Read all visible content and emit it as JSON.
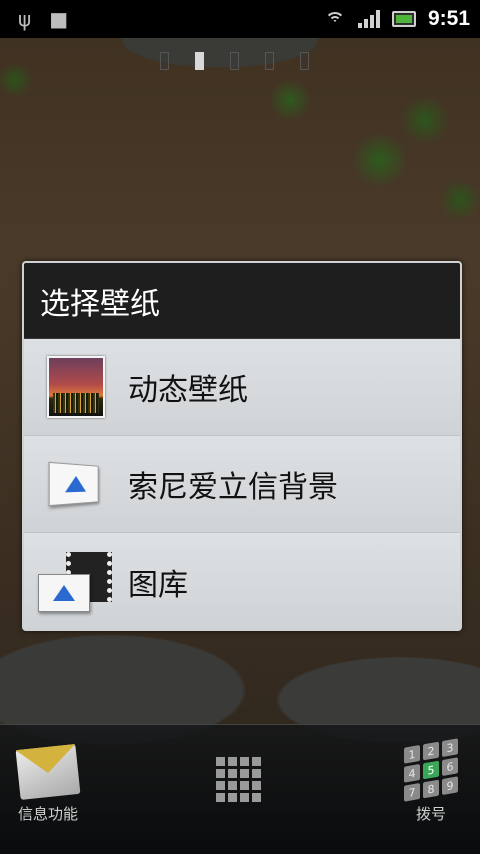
{
  "status_bar": {
    "time": "9:51",
    "left_icons": [
      "usb-icon",
      "android-debug-icon"
    ],
    "right_icons": [
      "wifi-icon",
      "signal-icon",
      "battery-charging-icon"
    ]
  },
  "home": {
    "page_count": 5,
    "active_page": 2
  },
  "dialog": {
    "title": "选择壁纸",
    "options": [
      {
        "label": "动态壁纸",
        "icon": "live-wallpaper-icon"
      },
      {
        "label": "索尼爱立信背景",
        "icon": "picture-icon"
      },
      {
        "label": "图库",
        "icon": "gallery-icon"
      }
    ]
  },
  "dock": {
    "messaging_label": "信息功能",
    "apps_icon": "app-drawer-icon",
    "dialer_label": "拨号",
    "dialer_keys": [
      "1",
      "2",
      "3",
      "4",
      "5",
      "6",
      "7",
      "8",
      "9"
    ]
  },
  "colors": {
    "dialog_title_bg": "#1e1e1e",
    "dialog_body_bg": "#d4d8db",
    "status_bar_bg": "#000000",
    "battery_fill": "#4fb53a",
    "dialer_highlight": "#3aa657"
  }
}
